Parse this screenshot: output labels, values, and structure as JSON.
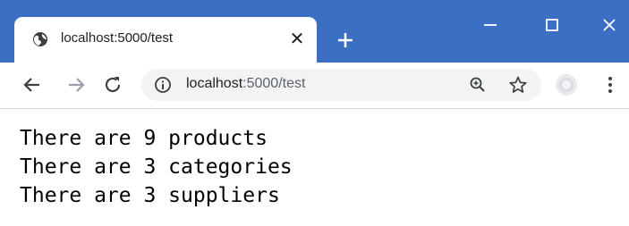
{
  "tab": {
    "title": "localhost:5000/test",
    "close_glyph": "✕"
  },
  "toolbar": {
    "url_host": "localhost",
    "url_rest": ":5000/test"
  },
  "icons": {
    "favicon": "globe-icon",
    "new_tab": "plus-icon",
    "minimize": "minimize-icon",
    "maximize": "maximize-icon",
    "close": "close-icon",
    "back": "arrow-left-icon",
    "forward": "arrow-right-icon",
    "reload": "reload-icon",
    "site_info": "info-icon",
    "zoom": "zoom-icon",
    "bookmark": "star-icon",
    "profile": "profile-icon",
    "menu": "kebab-menu-icon"
  },
  "colors": {
    "titlebar": "#3b6fc4",
    "omnibox": "#f1f3f4",
    "text": "#000000"
  },
  "page": {
    "lines": [
      "There are 9 products",
      "There are 3 categories",
      "There are 3 suppliers"
    ]
  }
}
